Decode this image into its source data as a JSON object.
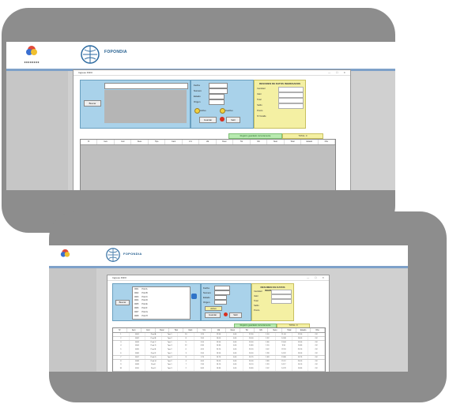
{
  "app": {
    "brand": "FOPONDIA",
    "window_title": "Ingreso INFO",
    "window_controls": "— ☐ ✕"
  },
  "form": {
    "search_label": "Buscar",
    "fields": [
      "Fecha",
      "Numero",
      "Estado",
      "Origen"
    ],
    "option_labels": [
      "Activo",
      "Inactivo"
    ],
    "save_label": "Guardar",
    "exit_label": "Salir"
  },
  "summary": {
    "title": "RESUMEN DE DATOS INGRESADOS",
    "labels": [
      "Cantidad",
      "Valor",
      "Total",
      "Saldo",
      "Precio",
      "Nº Detalle"
    ]
  },
  "status": {
    "green_text": "Registro guardado correctamente",
    "total_text": "TOTAL: 0"
  },
  "grid": {
    "columns": [
      "Nº",
      "Item",
      "Cod",
      "Desc",
      "Tipo",
      "Cant",
      "V.U.",
      "Val",
      "Desc",
      "Tot",
      "IVA",
      "Neto",
      "Total",
      "Estado",
      "Obs"
    ]
  },
  "second": {
    "search_label": "Buscar",
    "rows": [
      [
        "1",
        "0001",
        "Prod A",
        "Tipo 1",
        "10",
        "1.25",
        "12.50",
        "0.00",
        "12.50",
        "1.50",
        "11.00",
        "12.50",
        "OK"
      ],
      [
        "2",
        "0002",
        "Prod B",
        "Tipo 2",
        "8",
        "2.00",
        "16.00",
        "0.00",
        "16.00",
        "1.92",
        "14.08",
        "16.00",
        "OK"
      ],
      [
        "3",
        "0003",
        "Prod C",
        "Tipo 1",
        "5",
        "3.10",
        "15.50",
        "0.00",
        "15.50",
        "1.86",
        "13.64",
        "15.50",
        "OK"
      ],
      [
        "4",
        "0004",
        "Prod D",
        "Tipo 3",
        "12",
        "0.90",
        "10.80",
        "0.00",
        "10.80",
        "1.30",
        "9.50",
        "10.80",
        "OK"
      ],
      [
        "5",
        "0005",
        "Prod E",
        "Tipo 2",
        "6",
        "4.20",
        "25.20",
        "0.00",
        "25.20",
        "3.02",
        "22.18",
        "25.20",
        "OK"
      ],
      [
        "6",
        "0006",
        "Prod F",
        "Tipo 1",
        "3",
        "5.50",
        "16.50",
        "0.00",
        "16.50",
        "1.98",
        "14.52",
        "16.50",
        "OK"
      ],
      [
        "7",
        "0007",
        "Prod G",
        "Tipo 3",
        "9",
        "1.75",
        "15.75",
        "0.00",
        "15.75",
        "1.89",
        "13.86",
        "15.75",
        "OK"
      ],
      [
        "8",
        "0008",
        "Prod H",
        "Tipo 2",
        "4",
        "6.00",
        "24.00",
        "0.00",
        "24.00",
        "2.88",
        "21.12",
        "24.00",
        "OK"
      ],
      [
        "9",
        "0009",
        "Prod I",
        "Tipo 1",
        "7",
        "2.30",
        "16.10",
        "0.00",
        "16.10",
        "1.93",
        "14.17",
        "16.10",
        "OK"
      ],
      [
        "10",
        "0010",
        "Prod J",
        "Tipo 3",
        "2",
        "8.40",
        "16.80",
        "0.00",
        "16.80",
        "2.02",
        "14.78",
        "16.80",
        "OK"
      ]
    ]
  },
  "colors": {
    "panel": "#8d8d8d",
    "header_border": "#7ea1c9",
    "blue_box": "#a9d2ea",
    "yellow_box": "#f4f0a3",
    "green_status": "#b8eab0"
  }
}
